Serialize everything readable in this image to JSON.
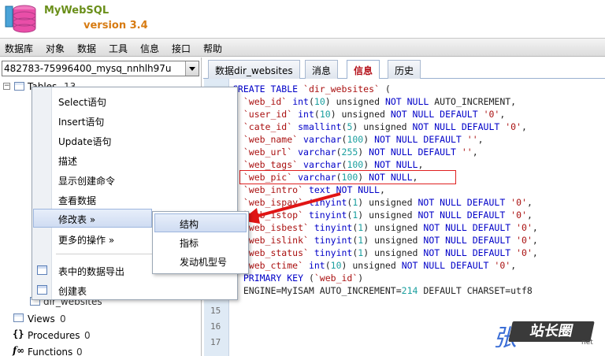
{
  "app": {
    "name": "MyWebSQL",
    "version": "version 3.4"
  },
  "menubar": [
    "数据库",
    "对象",
    "数据",
    "工具",
    "信息",
    "接口",
    "帮助"
  ],
  "db_selector": {
    "value": "482783-75996400_mysq_nnhlh97u"
  },
  "tree": {
    "tables_label": "Tables",
    "tables_count": "13",
    "table_item": "dir_websites",
    "views_label": "Views",
    "views_count": "0",
    "procedures_label": "Procedures",
    "procedures_count": "0",
    "functions_label": "Functions",
    "functions_count": "0"
  },
  "tabs": [
    {
      "label": "数据dir_websites",
      "active": false
    },
    {
      "label": "消息",
      "active": false
    },
    {
      "label": "信息",
      "active": true
    },
    {
      "label": "历史",
      "active": false
    }
  ],
  "context_menu": {
    "items": [
      "Select语句",
      "Insert语句",
      "Update语句",
      "描述",
      "显示创建命令",
      "查看数据",
      "修改表 »",
      "更多的操作 »",
      "表中的数据导出",
      "创建表"
    ],
    "selected": "修改表 »"
  },
  "submenu": {
    "items": [
      "结构",
      "指标",
      "发动机型号"
    ],
    "selected": "结构"
  },
  "editor": {
    "line_numbers": [
      "15",
      "16",
      "17"
    ],
    "code": [
      [
        [
          "kw",
          "CREATE TABLE "
        ],
        [
          "str",
          "`dir_websites`"
        ],
        [
          "plain",
          " ("
        ]
      ],
      [
        [
          "str",
          "  `web_id`"
        ],
        [
          "plain",
          " "
        ],
        [
          "kw",
          "int"
        ],
        [
          "plain",
          "("
        ],
        [
          "num",
          "10"
        ],
        [
          "plain",
          ") unsigned "
        ],
        [
          "kw",
          "NOT NULL"
        ],
        [
          "plain",
          " AUTO_INCREMENT,"
        ]
      ],
      [
        [
          "str",
          "  `user_id`"
        ],
        [
          "plain",
          " "
        ],
        [
          "kw",
          "int"
        ],
        [
          "plain",
          "("
        ],
        [
          "num",
          "10"
        ],
        [
          "plain",
          ") unsigned "
        ],
        [
          "kw",
          "NOT NULL DEFAULT"
        ],
        [
          "str",
          " '0'"
        ],
        [
          "plain",
          ","
        ]
      ],
      [
        [
          "str",
          "  `cate_id`"
        ],
        [
          "plain",
          " "
        ],
        [
          "kw",
          "smallint"
        ],
        [
          "plain",
          "("
        ],
        [
          "num",
          "5"
        ],
        [
          "plain",
          ") unsigned "
        ],
        [
          "kw",
          "NOT NULL DEFAULT"
        ],
        [
          "str",
          " '0'"
        ],
        [
          "plain",
          ","
        ]
      ],
      [
        [
          "str",
          "  `web_name`"
        ],
        [
          "plain",
          " "
        ],
        [
          "kw",
          "varchar"
        ],
        [
          "plain",
          "("
        ],
        [
          "num",
          "100"
        ],
        [
          "plain",
          ") "
        ],
        [
          "kw",
          "NOT NULL DEFAULT"
        ],
        [
          "str",
          " ''"
        ],
        [
          "plain",
          ","
        ]
      ],
      [
        [
          "str",
          "  `web_url`"
        ],
        [
          "plain",
          " "
        ],
        [
          "kw",
          "varchar"
        ],
        [
          "plain",
          "("
        ],
        [
          "num",
          "255"
        ],
        [
          "plain",
          ") "
        ],
        [
          "kw",
          "NOT NULL DEFAULT"
        ],
        [
          "str",
          " ''"
        ],
        [
          "plain",
          ","
        ]
      ],
      [
        [
          "str",
          "  `web_tags`"
        ],
        [
          "plain",
          " "
        ],
        [
          "kw",
          "varchar"
        ],
        [
          "plain",
          "("
        ],
        [
          "num",
          "100"
        ],
        [
          "plain",
          ") "
        ],
        [
          "kw",
          "NOT NULL"
        ],
        [
          "plain",
          ","
        ]
      ],
      [
        [
          "str",
          "  `web_pic`"
        ],
        [
          "plain",
          " "
        ],
        [
          "kw",
          "varchar"
        ],
        [
          "plain",
          "("
        ],
        [
          "num",
          "100"
        ],
        [
          "plain",
          ") "
        ],
        [
          "kw",
          "NOT NULL"
        ],
        [
          "plain",
          ","
        ]
      ],
      [
        [
          "str",
          "  `web_intro`"
        ],
        [
          "plain",
          " "
        ],
        [
          "kw",
          "text"
        ],
        [
          "plain",
          " "
        ],
        [
          "kw",
          "NOT NULL"
        ],
        [
          "plain",
          ","
        ]
      ],
      [
        [
          "str",
          "  `web_ispay`"
        ],
        [
          "plain",
          " "
        ],
        [
          "kw",
          "tinyint"
        ],
        [
          "plain",
          "("
        ],
        [
          "num",
          "1"
        ],
        [
          "plain",
          ") unsigned "
        ],
        [
          "kw",
          "NOT NULL DEFAULT"
        ],
        [
          "str",
          " '0'"
        ],
        [
          "plain",
          ","
        ]
      ],
      [
        [
          "str",
          "  `web_istop`"
        ],
        [
          "plain",
          " "
        ],
        [
          "kw",
          "tinyint"
        ],
        [
          "plain",
          "("
        ],
        [
          "num",
          "1"
        ],
        [
          "plain",
          ") unsigned "
        ],
        [
          "kw",
          "NOT NULL DEFAULT"
        ],
        [
          "str",
          " '0'"
        ],
        [
          "plain",
          ","
        ]
      ],
      [
        [
          "str",
          "  `web_isbest`"
        ],
        [
          "plain",
          " "
        ],
        [
          "kw",
          "tinyint"
        ],
        [
          "plain",
          "("
        ],
        [
          "num",
          "1"
        ],
        [
          "plain",
          ") unsigned "
        ],
        [
          "kw",
          "NOT NULL DEFAULT"
        ],
        [
          "str",
          " '0'"
        ],
        [
          "plain",
          ","
        ]
      ],
      [
        [
          "str",
          "  `web_islink`"
        ],
        [
          "plain",
          " "
        ],
        [
          "kw",
          "tinyint"
        ],
        [
          "plain",
          "("
        ],
        [
          "num",
          "1"
        ],
        [
          "plain",
          ") unsigned "
        ],
        [
          "kw",
          "NOT NULL DEFAULT"
        ],
        [
          "str",
          " '0'"
        ],
        [
          "plain",
          ","
        ]
      ],
      [
        [
          "str",
          "  `web_status`"
        ],
        [
          "plain",
          " "
        ],
        [
          "kw",
          "tinyint"
        ],
        [
          "plain",
          "("
        ],
        [
          "num",
          "1"
        ],
        [
          "plain",
          ") unsigned "
        ],
        [
          "kw",
          "NOT NULL DEFAULT"
        ],
        [
          "str",
          " '0'"
        ],
        [
          "plain",
          ","
        ]
      ],
      [
        [
          "str",
          "  `web_ctime`"
        ],
        [
          "plain",
          " "
        ],
        [
          "kw",
          "int"
        ],
        [
          "plain",
          "("
        ],
        [
          "num",
          "10"
        ],
        [
          "plain",
          ") unsigned "
        ],
        [
          "kw",
          "NOT NULL DEFAULT"
        ],
        [
          "str",
          " '0'"
        ],
        [
          "plain",
          ","
        ]
      ],
      [
        [
          "kw",
          "  PRIMARY KEY"
        ],
        [
          "plain",
          " ("
        ],
        [
          "str",
          "`web_id`"
        ],
        [
          "plain",
          ")"
        ]
      ],
      [
        [
          "plain",
          ") ENGINE=MyISAM AUTO_INCREMENT="
        ],
        [
          "num",
          "214"
        ],
        [
          "plain",
          " DEFAULT CHARSET=utf8"
        ]
      ]
    ]
  },
  "watermark": {
    "text": "站长圈",
    "sub": "net"
  }
}
